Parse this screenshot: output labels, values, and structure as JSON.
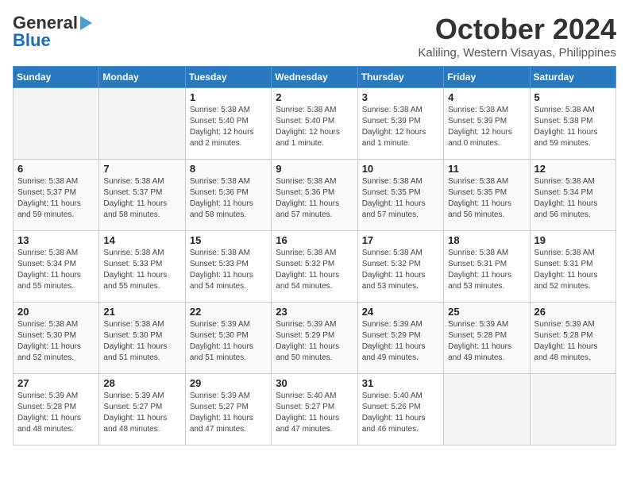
{
  "header": {
    "logo_line1": "General",
    "logo_line2": "Blue",
    "month": "October 2024",
    "location": "Kaliling, Western Visayas, Philippines"
  },
  "columns": [
    "Sunday",
    "Monday",
    "Tuesday",
    "Wednesday",
    "Thursday",
    "Friday",
    "Saturday"
  ],
  "weeks": [
    [
      {
        "day": "",
        "detail": ""
      },
      {
        "day": "",
        "detail": ""
      },
      {
        "day": "1",
        "detail": "Sunrise: 5:38 AM\nSunset: 5:40 PM\nDaylight: 12 hours\nand 2 minutes."
      },
      {
        "day": "2",
        "detail": "Sunrise: 5:38 AM\nSunset: 5:40 PM\nDaylight: 12 hours\nand 1 minute."
      },
      {
        "day": "3",
        "detail": "Sunrise: 5:38 AM\nSunset: 5:39 PM\nDaylight: 12 hours\nand 1 minute."
      },
      {
        "day": "4",
        "detail": "Sunrise: 5:38 AM\nSunset: 5:39 PM\nDaylight: 12 hours\nand 0 minutes."
      },
      {
        "day": "5",
        "detail": "Sunrise: 5:38 AM\nSunset: 5:38 PM\nDaylight: 11 hours\nand 59 minutes."
      }
    ],
    [
      {
        "day": "6",
        "detail": "Sunrise: 5:38 AM\nSunset: 5:37 PM\nDaylight: 11 hours\nand 59 minutes."
      },
      {
        "day": "7",
        "detail": "Sunrise: 5:38 AM\nSunset: 5:37 PM\nDaylight: 11 hours\nand 58 minutes."
      },
      {
        "day": "8",
        "detail": "Sunrise: 5:38 AM\nSunset: 5:36 PM\nDaylight: 11 hours\nand 58 minutes."
      },
      {
        "day": "9",
        "detail": "Sunrise: 5:38 AM\nSunset: 5:36 PM\nDaylight: 11 hours\nand 57 minutes."
      },
      {
        "day": "10",
        "detail": "Sunrise: 5:38 AM\nSunset: 5:35 PM\nDaylight: 11 hours\nand 57 minutes."
      },
      {
        "day": "11",
        "detail": "Sunrise: 5:38 AM\nSunset: 5:35 PM\nDaylight: 11 hours\nand 56 minutes."
      },
      {
        "day": "12",
        "detail": "Sunrise: 5:38 AM\nSunset: 5:34 PM\nDaylight: 11 hours\nand 56 minutes."
      }
    ],
    [
      {
        "day": "13",
        "detail": "Sunrise: 5:38 AM\nSunset: 5:34 PM\nDaylight: 11 hours\nand 55 minutes."
      },
      {
        "day": "14",
        "detail": "Sunrise: 5:38 AM\nSunset: 5:33 PM\nDaylight: 11 hours\nand 55 minutes."
      },
      {
        "day": "15",
        "detail": "Sunrise: 5:38 AM\nSunset: 5:33 PM\nDaylight: 11 hours\nand 54 minutes."
      },
      {
        "day": "16",
        "detail": "Sunrise: 5:38 AM\nSunset: 5:32 PM\nDaylight: 11 hours\nand 54 minutes."
      },
      {
        "day": "17",
        "detail": "Sunrise: 5:38 AM\nSunset: 5:32 PM\nDaylight: 11 hours\nand 53 minutes."
      },
      {
        "day": "18",
        "detail": "Sunrise: 5:38 AM\nSunset: 5:31 PM\nDaylight: 11 hours\nand 53 minutes."
      },
      {
        "day": "19",
        "detail": "Sunrise: 5:38 AM\nSunset: 5:31 PM\nDaylight: 11 hours\nand 52 minutes."
      }
    ],
    [
      {
        "day": "20",
        "detail": "Sunrise: 5:38 AM\nSunset: 5:30 PM\nDaylight: 11 hours\nand 52 minutes."
      },
      {
        "day": "21",
        "detail": "Sunrise: 5:38 AM\nSunset: 5:30 PM\nDaylight: 11 hours\nand 51 minutes."
      },
      {
        "day": "22",
        "detail": "Sunrise: 5:39 AM\nSunset: 5:30 PM\nDaylight: 11 hours\nand 51 minutes."
      },
      {
        "day": "23",
        "detail": "Sunrise: 5:39 AM\nSunset: 5:29 PM\nDaylight: 11 hours\nand 50 minutes."
      },
      {
        "day": "24",
        "detail": "Sunrise: 5:39 AM\nSunset: 5:29 PM\nDaylight: 11 hours\nand 49 minutes."
      },
      {
        "day": "25",
        "detail": "Sunrise: 5:39 AM\nSunset: 5:28 PM\nDaylight: 11 hours\nand 49 minutes."
      },
      {
        "day": "26",
        "detail": "Sunrise: 5:39 AM\nSunset: 5:28 PM\nDaylight: 11 hours\nand 48 minutes."
      }
    ],
    [
      {
        "day": "27",
        "detail": "Sunrise: 5:39 AM\nSunset: 5:28 PM\nDaylight: 11 hours\nand 48 minutes."
      },
      {
        "day": "28",
        "detail": "Sunrise: 5:39 AM\nSunset: 5:27 PM\nDaylight: 11 hours\nand 48 minutes."
      },
      {
        "day": "29",
        "detail": "Sunrise: 5:39 AM\nSunset: 5:27 PM\nDaylight: 11 hours\nand 47 minutes."
      },
      {
        "day": "30",
        "detail": "Sunrise: 5:40 AM\nSunset: 5:27 PM\nDaylight: 11 hours\nand 47 minutes."
      },
      {
        "day": "31",
        "detail": "Sunrise: 5:40 AM\nSunset: 5:26 PM\nDaylight: 11 hours\nand 46 minutes."
      },
      {
        "day": "",
        "detail": ""
      },
      {
        "day": "",
        "detail": ""
      }
    ]
  ]
}
